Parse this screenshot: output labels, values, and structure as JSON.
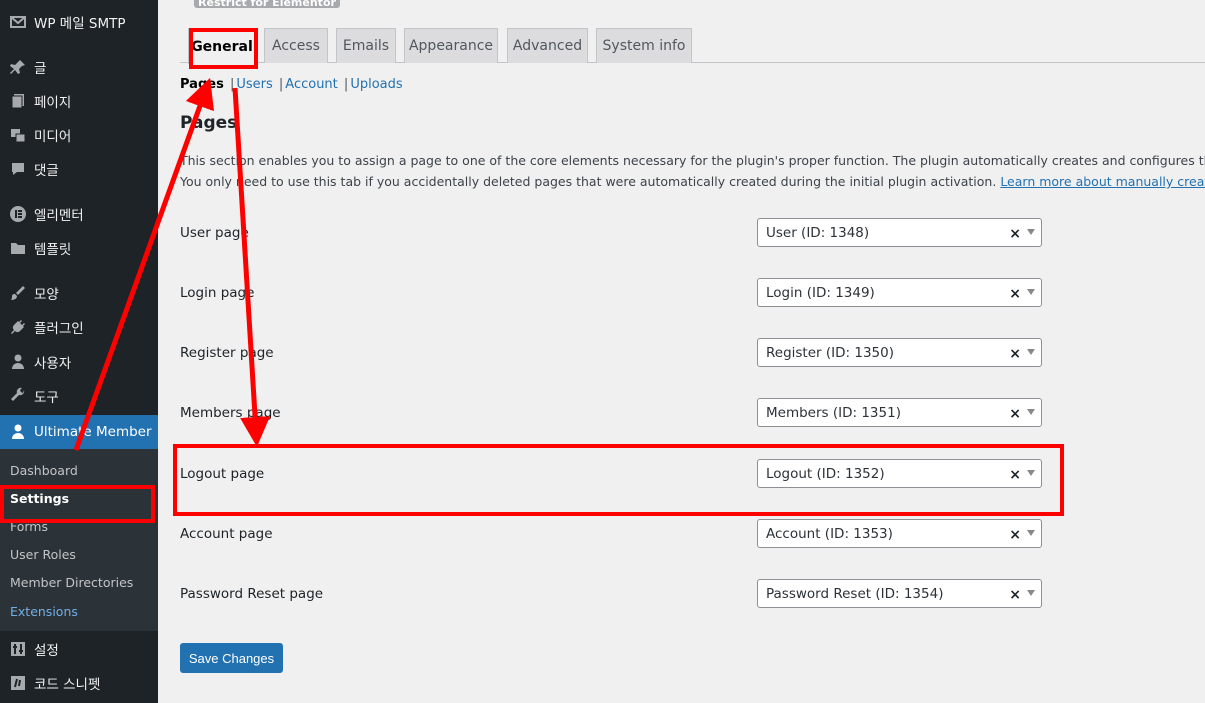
{
  "sidebar": {
    "items": [
      {
        "label": "WP 메일 SMTP",
        "icon": "mail-icon"
      },
      {
        "label": "글",
        "icon": "pin-icon"
      },
      {
        "label": "페이지",
        "icon": "pages-icon"
      },
      {
        "label": "미디어",
        "icon": "media-icon"
      },
      {
        "label": "댓글",
        "icon": "comment-icon"
      },
      {
        "label": "엘리멘터",
        "icon": "elementor-icon"
      },
      {
        "label": "템플릿",
        "icon": "folder-icon"
      },
      {
        "label": "모양",
        "icon": "brush-icon"
      },
      {
        "label": "플러그인",
        "icon": "plugin-icon"
      },
      {
        "label": "사용자",
        "icon": "user-icon"
      },
      {
        "label": "도구",
        "icon": "wrench-icon"
      },
      {
        "label": "Ultimate Member",
        "icon": "member-icon"
      },
      {
        "label": "설정",
        "icon": "settings-icon"
      },
      {
        "label": "코드 스니펫",
        "icon": "code-icon"
      }
    ],
    "submenu": [
      "Dashboard",
      "Settings",
      "Forms",
      "User Roles",
      "Member Directories",
      "Extensions"
    ]
  },
  "header": {
    "badge": "Restrict for Elementor"
  },
  "tabs": [
    "General",
    "Access",
    "Emails",
    "Appearance",
    "Advanced",
    "System info"
  ],
  "subnav": {
    "current": "Pages",
    "links": [
      "Users",
      "Account",
      "Uploads"
    ],
    "sep": "|"
  },
  "section": {
    "title": "Pages",
    "desc_line1": "This section enables you to assign a page to one of the core elements necessary for the plugin's proper function. The plugin automatically creates and configures the required pages",
    "desc_line2_pre": "You only need to use this tab if you accidentally deleted pages that were automatically created during the initial plugin activation. ",
    "desc_link": "Learn more about manually creating pages",
    "desc_line2_post": "."
  },
  "rows": [
    {
      "label": "User page",
      "value": "User (ID: 1348)"
    },
    {
      "label": "Login page",
      "value": "Login (ID: 1349)"
    },
    {
      "label": "Register page",
      "value": "Register (ID: 1350)"
    },
    {
      "label": "Members page",
      "value": "Members (ID: 1351)"
    },
    {
      "label": "Logout page",
      "value": "Logout (ID: 1352)"
    },
    {
      "label": "Account page",
      "value": "Account (ID: 1353)"
    },
    {
      "label": "Password Reset page",
      "value": "Password Reset (ID: 1354)"
    }
  ],
  "clear_glyph": "×",
  "save_label": "Save Changes",
  "colors": {
    "accent": "#2271b1",
    "annotation": "#ff0000",
    "sidebar_bg": "#1d2327"
  }
}
